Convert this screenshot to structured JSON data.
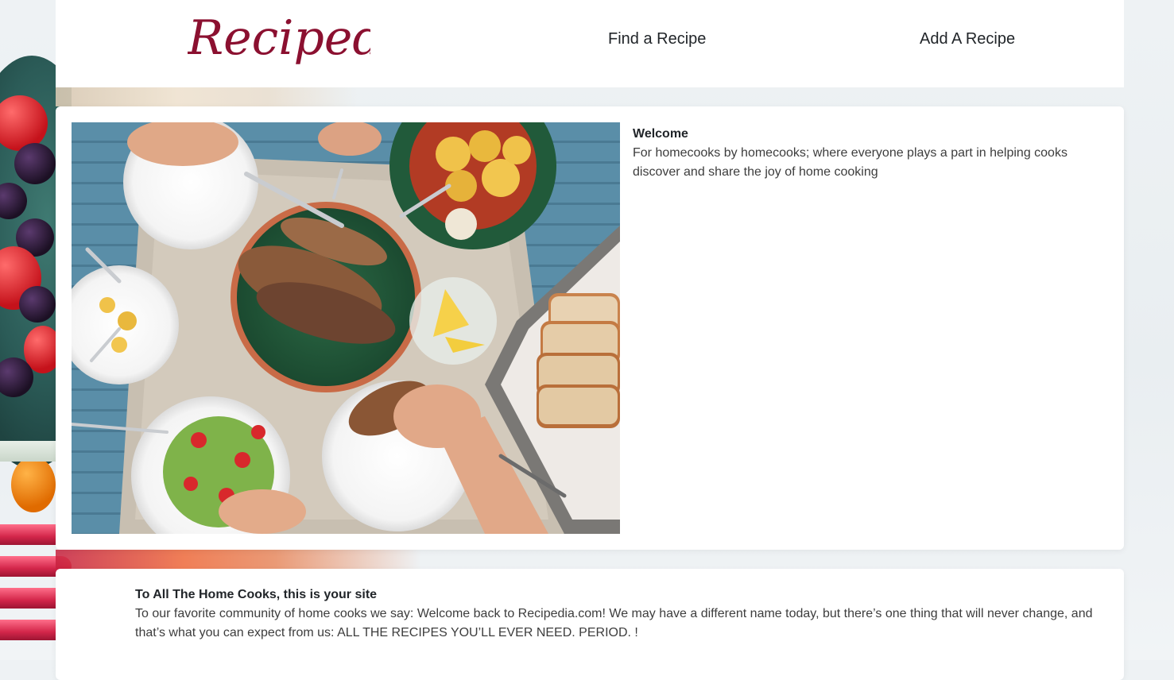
{
  "brand": {
    "logo_text": "Recipedia",
    "logo_color": "#8b1030"
  },
  "nav": {
    "find_recipe": "Find a Recipe",
    "add_recipe": "Add A Recipe"
  },
  "welcome": {
    "title": "Welcome",
    "body": "For homecooks by homecooks; where everyone plays a part in helping cooks discover and share the joy of home cooking"
  },
  "homecooks": {
    "title": "To All The Home Cooks, this is your site",
    "body": "To our favorite community of home cooks we say: Welcome back to Recipedia.com! We may have a different name today, but there’s one thing that will never change, and that’s what you can expect from us: ALL THE RECIPES YOU’LL EVER NEED. PERIOD. !"
  },
  "colors": {
    "page_background": "#eef2f4",
    "card_background": "#ffffff",
    "text_primary": "#212529"
  }
}
